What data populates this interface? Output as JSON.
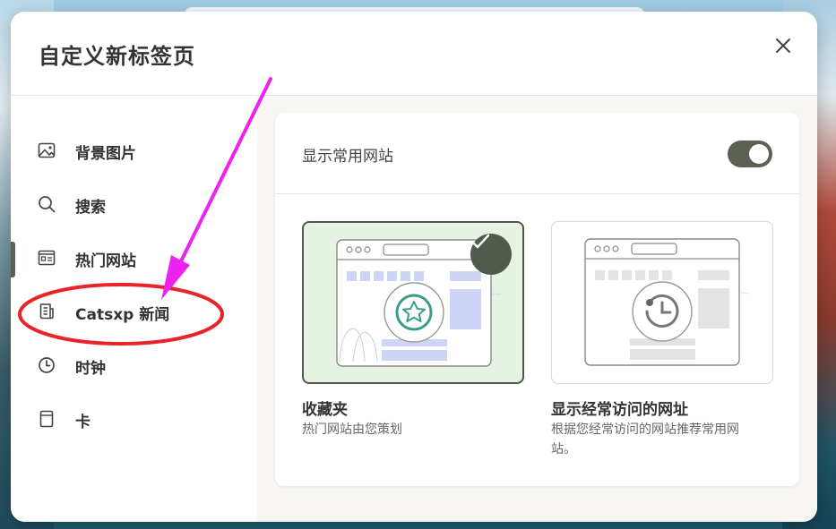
{
  "modal": {
    "title": "自定义新标签页"
  },
  "sidebar": {
    "items": [
      {
        "label": "背景图片",
        "icon": "image-icon"
      },
      {
        "label": "搜索",
        "icon": "search-icon"
      },
      {
        "label": "热门网站",
        "icon": "top-sites-icon",
        "active": true
      },
      {
        "label": "Catsxp 新闻",
        "icon": "news-icon"
      },
      {
        "label": "时钟",
        "icon": "clock-icon"
      },
      {
        "label": "卡",
        "icon": "card-icon"
      }
    ]
  },
  "content": {
    "show_top_sites_label": "显示常用网站",
    "toggle_on": true,
    "options": [
      {
        "title": "收藏夹",
        "desc": "热门网站由您策划",
        "selected": true
      },
      {
        "title": "显示经常访问的网址",
        "desc": "根据您经常访问的网站推荐常用网站。",
        "selected": false
      }
    ]
  },
  "colors": {
    "accent": "#5a6152",
    "selected_bg": "#e7f3e2",
    "annotation_arrow": "#ee22ee",
    "annotation_circle": "#e8232a"
  }
}
